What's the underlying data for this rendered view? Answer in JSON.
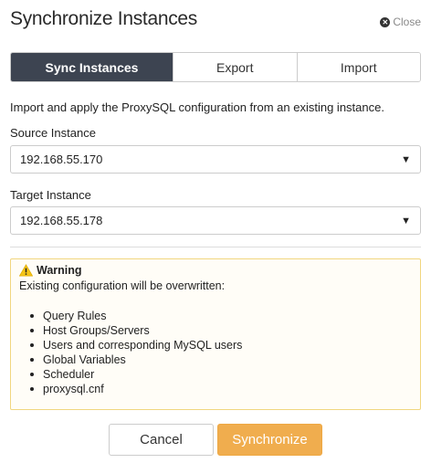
{
  "dialog": {
    "title": "Synchronize Instances",
    "close_label": "Close",
    "close_icon": "close-icon"
  },
  "tabs": [
    {
      "label": "Sync Instances",
      "active": true
    },
    {
      "label": "Export",
      "active": false
    },
    {
      "label": "Import",
      "active": false
    }
  ],
  "description": "Import and apply the ProxySQL configuration from an existing instance.",
  "source": {
    "label": "Source Instance",
    "value": "192.168.55.170"
  },
  "target": {
    "label": "Target Instance",
    "value": "192.168.55.178"
  },
  "warning": {
    "title": "Warning",
    "text": "Existing configuration will be overwritten:",
    "items": [
      "Query Rules",
      "Host Groups/Servers",
      "Users and corresponding MySQL users",
      "Global Variables",
      "Scheduler",
      "proxysql.cnf"
    ],
    "icon": "warning-icon",
    "border_color": "#f1d67f"
  },
  "buttons": {
    "cancel": "Cancel",
    "synchronize": "Synchronize",
    "synchronize_color": "#f0ad4e"
  },
  "colors": {
    "active_tab": "#3d4451"
  }
}
